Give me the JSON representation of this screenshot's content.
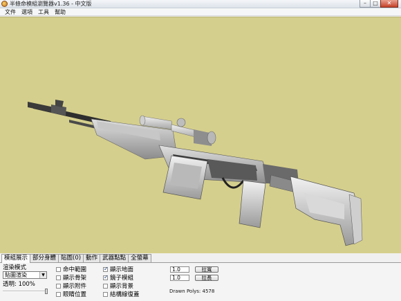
{
  "window": {
    "title": "半條命模組瀏覽器v1.36 - 中文版",
    "buttons": {
      "minimize": "–",
      "maximize": "□",
      "close": "✕"
    }
  },
  "menu": [
    "文件",
    "選項",
    "工具",
    "幫助"
  ],
  "viewport": {
    "background": "#d5cf8d",
    "model": "rifle-model"
  },
  "tabs": [
    "模組展示",
    "部分身體",
    "貼圖(0)",
    "動作",
    "武器點點",
    "全螢幕"
  ],
  "active_tab": 0,
  "panel": {
    "render_mode_label": "渲染模式",
    "render_mode_value": "貼圖渲染",
    "transparency_label": "透明: 100%",
    "transparency_value": 1.0,
    "col2": [
      {
        "label": "命中範圍",
        "checked": false
      },
      {
        "label": "顯示骨架",
        "checked": false
      },
      {
        "label": "顯示附件",
        "checked": false
      },
      {
        "label": "眼睛位置",
        "checked": false
      }
    ],
    "col3": [
      {
        "label": "顯示地面",
        "checked": true
      },
      {
        "label": "鏡子模組",
        "checked": true
      },
      {
        "label": "顯示背景",
        "checked": false
      },
      {
        "label": "結構線復蓋",
        "checked": false
      }
    ],
    "field1_value": "1.0",
    "field2_value": "1.0",
    "button1_label": "拉寬",
    "button2_label": "拉長",
    "drawn_polys": "Drawn Polys: 4578"
  }
}
